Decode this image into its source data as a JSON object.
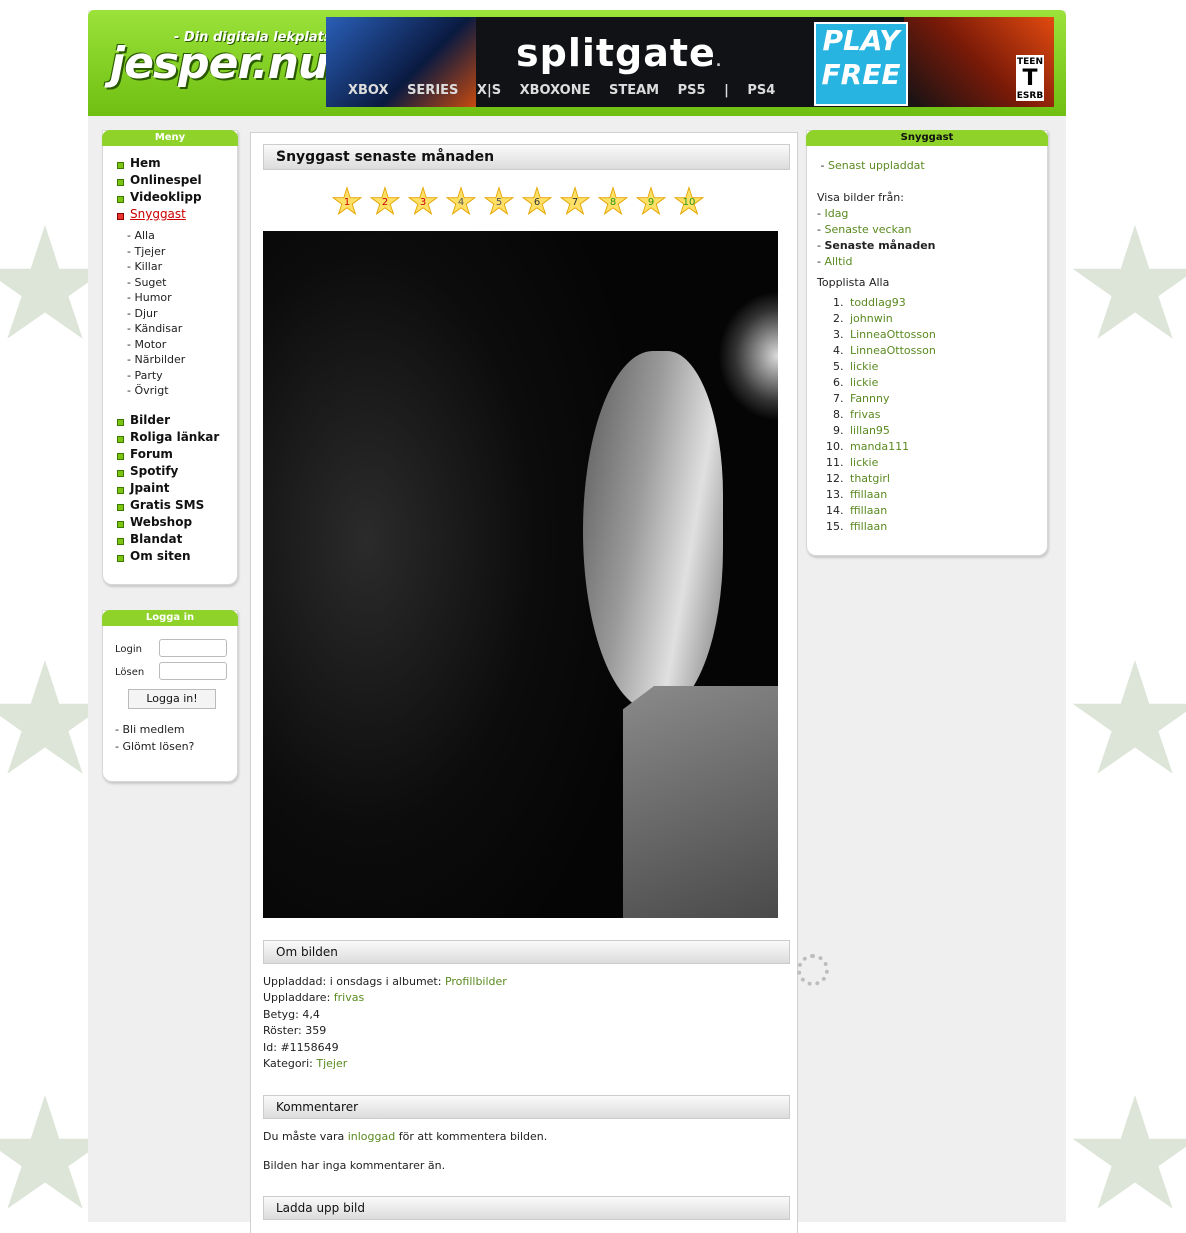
{
  "site": {
    "logo": "jesper.nu",
    "tagline": "- Din digitala lekplats!"
  },
  "banner": {
    "title": "splitgate",
    "platforms": "XBOX SERIES X|S XBOXONE STEAM PS5 | PS4",
    "cta": "PLAY FREE",
    "rating_top": "TEEN",
    "rating_letter": "T",
    "rating_bottom": "ESRB"
  },
  "menu": {
    "heading": "Meny",
    "items_top": [
      "Hem",
      "Onlinespel",
      "Videoklipp"
    ],
    "active": "Snyggast",
    "sub": [
      "Alla",
      "Tjejer",
      "Killar",
      "Suget",
      "Humor",
      "Djur",
      "Kändisar",
      "Motor",
      "Närbilder",
      "Party",
      "Övrigt"
    ],
    "items_bottom": [
      "Bilder",
      "Roliga länkar",
      "Forum",
      "Spotify",
      "Jpaint",
      "Gratis SMS",
      "Webshop",
      "Blandat",
      "Om siten"
    ]
  },
  "login": {
    "heading": "Logga in",
    "login_label": "Login",
    "password_label": "Lösen",
    "button": "Logga in!",
    "join": "Bli medlem",
    "forgot": "Glömt lösen?"
  },
  "main": {
    "title": "Snyggast senaste månaden",
    "ratings": [
      "1",
      "2",
      "3",
      "4",
      "5",
      "6",
      "7",
      "8",
      "9",
      "10"
    ],
    "about_heading": "Om bilden",
    "uploaded_label": "Uppladdad:",
    "uploaded_value": "i onsdags i albumet:",
    "album": "Profillbilder",
    "uploader_label": "Uppladdare:",
    "uploader": "frivas",
    "score_label": "Betyg:",
    "score": "4,4",
    "votes_label": "Röster:",
    "votes": "359",
    "id_label": "Id:",
    "id": "#1158649",
    "category_label": "Kategori:",
    "category": "Tjejer",
    "comments_heading": "Kommentarer",
    "comment_prefix": "Du måste vara",
    "comment_link": "inloggad",
    "comment_suffix": "för att kommentera bilden.",
    "no_comments": "Bilden har inga kommentarer än.",
    "upload_heading": "Ladda upp bild"
  },
  "sidebar": {
    "heading": "Snyggast",
    "latest": "Senast uppladdat",
    "show_from": "Visa bilder från:",
    "periods": [
      "Idag",
      "Senaste veckan"
    ],
    "current_period": "Senaste månaden",
    "period_all": "Alltid",
    "toplist_heading": "Topplista Alla",
    "toplist": [
      "toddlag93",
      "johnwin",
      "LinneaOttosson",
      "LinneaOttosson",
      "lickie",
      "lickie",
      "Fannny",
      "frivas",
      "lillan95",
      "manda111",
      "lickie",
      "thatgirl",
      "ffillaan",
      "ffillaan",
      "ffillaan"
    ]
  },
  "colors": {
    "brand_green": "#8fd22a",
    "link_green": "#5a8a20",
    "active_red": "#cc0000"
  }
}
